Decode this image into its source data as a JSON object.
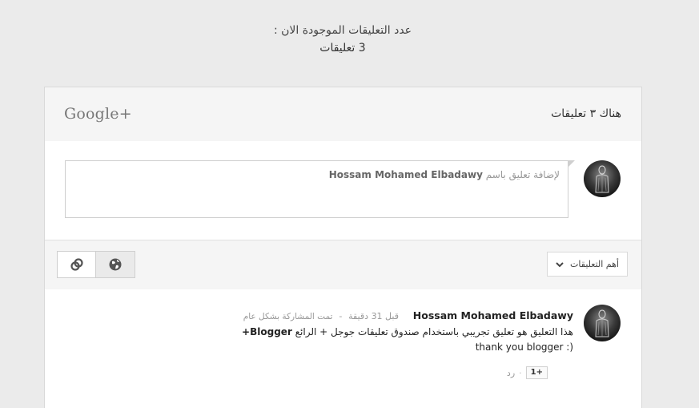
{
  "page": {
    "count_heading": "عدد التعليقات الموجودة الان :",
    "count_value": "3 تعليقات"
  },
  "widget": {
    "logo": "Google+",
    "header_count": "هناك ٣ تعليقات",
    "compose": {
      "placeholder_prefix": "لإضافة تعليق باسم",
      "placeholder_user": "Hossam Mohamed Elbadawy"
    },
    "toolbar": {
      "sort_label": "أهم التعليقات",
      "sort_icon": "chevron-down-icon",
      "buttons": [
        {
          "icon": "link-icon",
          "active": false
        },
        {
          "icon": "globe-icon",
          "active": true
        }
      ]
    },
    "comments": [
      {
        "author": "Hossam Mohamed Elbadawy",
        "time": "قبل 31 دقيقة",
        "separator": "-",
        "share_status": "تمت المشاركة بشكل عام",
        "text_line1": "هذا التعليق هو تعليق تجريبي باستخدام صندوق تعليقات جوجل + الرائع",
        "text_line1_bold": "Blogger+",
        "text_line2": "thank you blogger :)",
        "plus_one": "+1",
        "dot": "·",
        "reply": "رد"
      }
    ]
  }
}
